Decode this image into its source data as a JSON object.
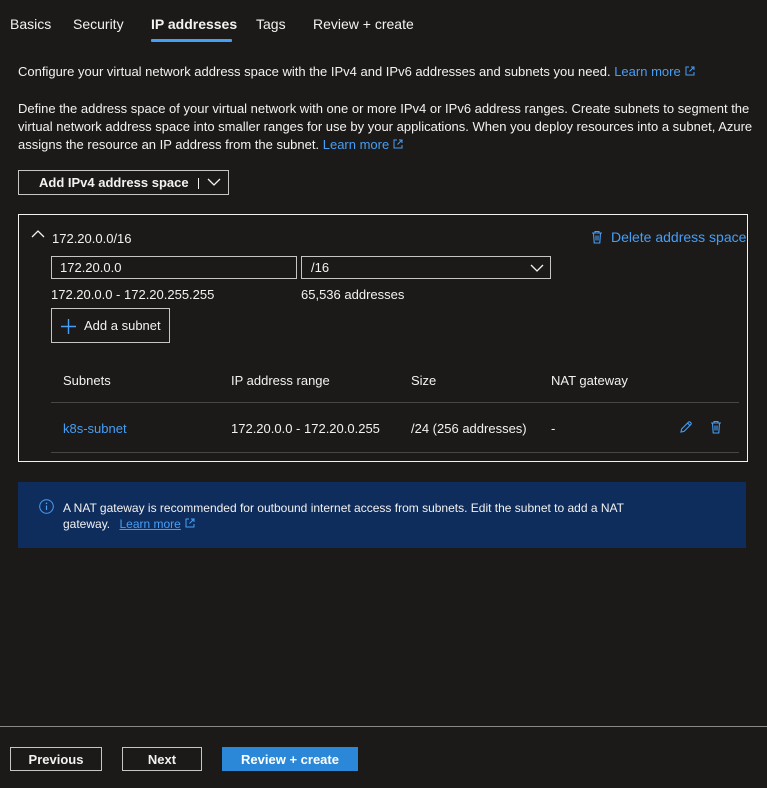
{
  "tabs": [
    {
      "label": "Basics"
    },
    {
      "label": "Security"
    },
    {
      "label": "IP addresses"
    },
    {
      "label": "Tags"
    },
    {
      "label": "Review + create"
    }
  ],
  "active_tab": "IP addresses",
  "intro": {
    "text": "Configure your virtual network address space with the IPv4 and IPv6 addresses and subnets you need.",
    "link": "Learn more"
  },
  "description": {
    "text": "Define the address space of your virtual network with one or more IPv4 or IPv6 address ranges. Create subnets to segment the virtual network address space into smaller ranges for use by your applications. When you deploy resources into a subnet, Azure assigns the resource an IP address from the subnet.",
    "link": "Learn more"
  },
  "add_space_button": {
    "label": "Add IPv4 address space"
  },
  "address_space": {
    "title": "172.20.0.0/16",
    "delete_label": "Delete address space",
    "ip_value": "172.20.0.0",
    "prefix_value": "/16",
    "range": "172.20.0.0 - 172.20.255.255",
    "count": "65,536 addresses",
    "add_subnet_label": "Add a subnet"
  },
  "subnets_table": {
    "headers": {
      "name": "Subnets",
      "range": "IP address range",
      "size": "Size",
      "nat": "NAT gateway"
    },
    "rows": [
      {
        "name": "k8s-subnet",
        "range": "172.20.0.0 - 172.20.0.255",
        "size": "/24 (256 addresses)",
        "nat": "-"
      }
    ]
  },
  "info_bar": {
    "text": "A NAT gateway is recommended for outbound internet access from subnets. Edit the subnet to add a NAT gateway.",
    "link": "Learn more"
  },
  "footer": {
    "previous": "Previous",
    "next": "Next",
    "review_create": "Review + create"
  },
  "colors": {
    "background": "#1b1a19",
    "accent": "#479ef5",
    "primary_button": "#2b88d8",
    "info_bar": "#0f2d5c"
  }
}
